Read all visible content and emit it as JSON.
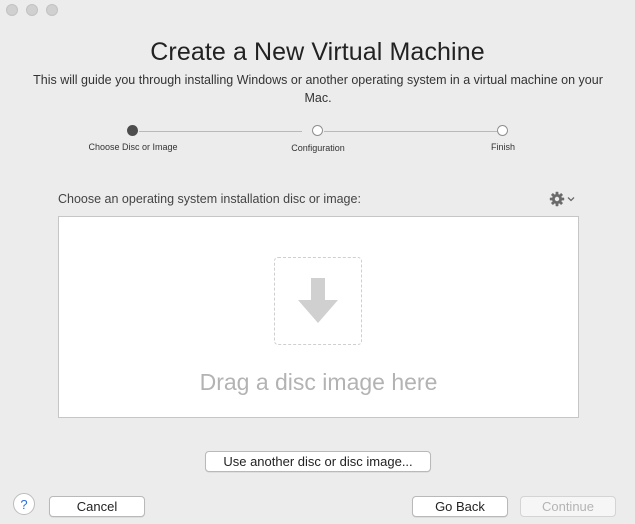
{
  "window": {
    "title": "Create a New Virtual Machine",
    "subtitle": "This will guide you through installing Windows or another operating system in a virtual machine on your Mac."
  },
  "steps": [
    {
      "label": "Choose Disc or Image",
      "active": true
    },
    {
      "label": "Configuration",
      "active": false
    },
    {
      "label": "Finish",
      "active": false
    }
  ],
  "prompt": "Choose an operating system installation disc or image:",
  "dropzone": {
    "text": "Drag a disc image here",
    "icon": "download-arrow-icon"
  },
  "icons": {
    "gear": "gear-icon",
    "chevron": "chevron-down-icon",
    "help": "help-icon"
  },
  "buttons": {
    "use_another": "Use another disc or disc image...",
    "cancel": "Cancel",
    "go_back": "Go Back",
    "continue": "Continue",
    "help": "?"
  }
}
